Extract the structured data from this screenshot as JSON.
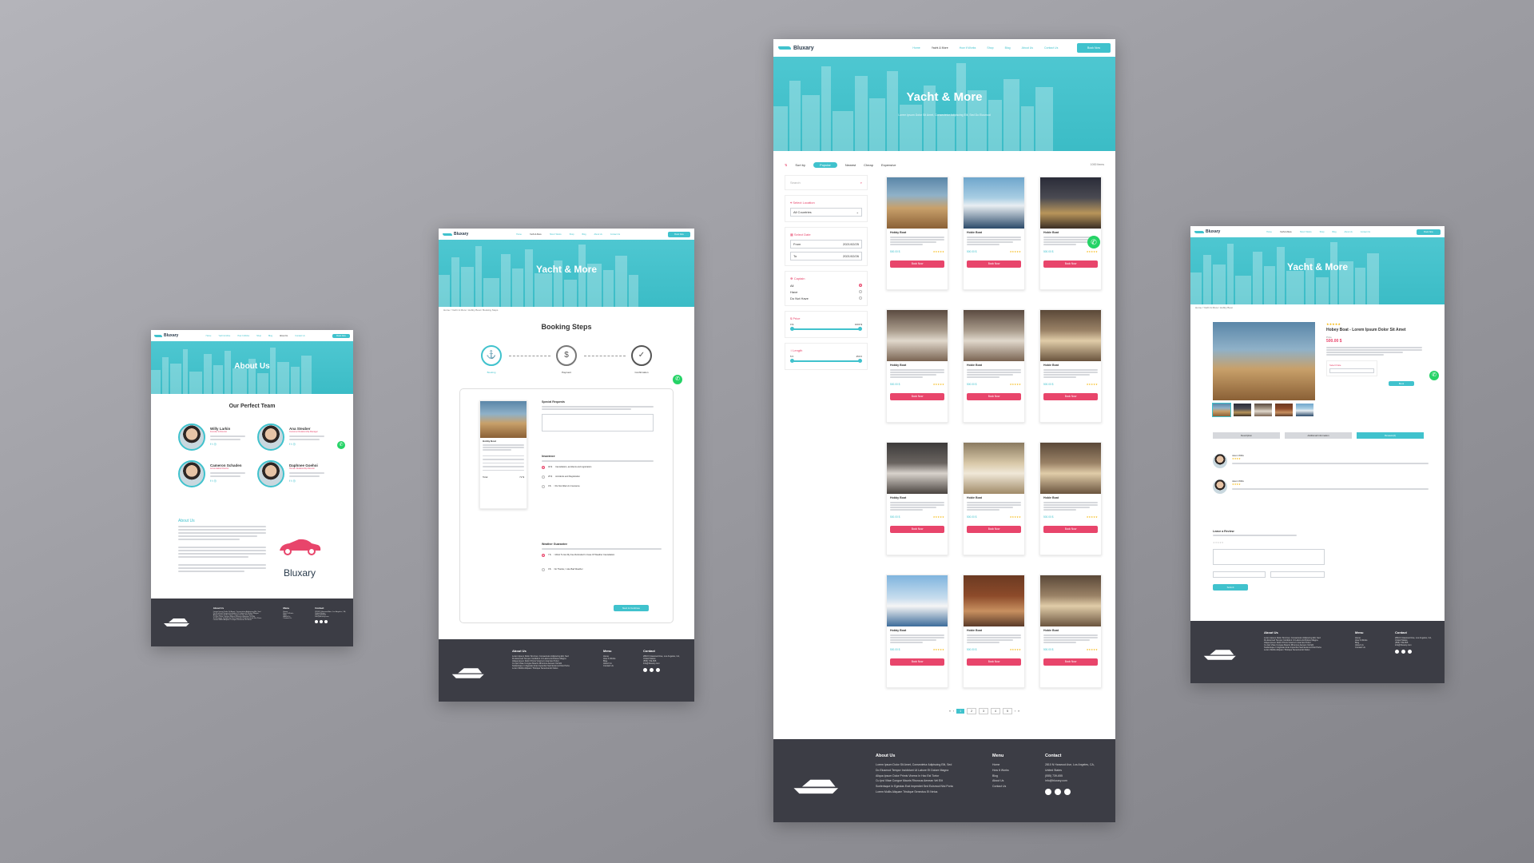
{
  "brand": {
    "name": "Bluxary",
    "accent": "#40c2cd",
    "pink": "#e8456b",
    "footer_bg": "#3c3d45"
  },
  "nav": {
    "items": [
      "Home",
      "Yacht & More",
      "How It Works",
      "Shop",
      "Blog",
      "About Us",
      "Contact Us"
    ],
    "cta": "Book Now"
  },
  "about": {
    "hero_title": "About Us",
    "team_title": "Our Perfect Team",
    "members": [
      {
        "name": "Willy Larkin",
        "role": "Founder & Director"
      },
      {
        "name": "Ana Steuber",
        "role": "Customer Relationship Manager"
      },
      {
        "name": "Cameron Schaden",
        "role": "Accountable Director"
      },
      {
        "name": "Daphnee Goehoi",
        "role": "Human Relationship Director"
      }
    ],
    "about_heading": "About Us",
    "logo_word": "Bluxary"
  },
  "booking": {
    "hero_title": "Yacht & More",
    "breadcrumb": "Home / Yacht & More / Hobby Boat / Booking Steps",
    "title": "Booking Steps",
    "steps": [
      "Booking",
      "Payment",
      "Confirmation"
    ],
    "special_requests": "Special Requests",
    "insurance": "Insurance",
    "insurance_options": [
      {
        "price": "40 $",
        "label": "Cancellation, accidents and registration"
      },
      {
        "price": "25 $",
        "label": "Accidents and Registration"
      },
      {
        "price": "0 $",
        "label": "I Do Not Want An Insurance"
      }
    ],
    "weather": "Weather Guarantee",
    "weather_options": [
      {
        "price": "7 $",
        "label": "I Want To Get My Fee Refunded In Case Of Weather Cancellation"
      },
      {
        "price": "0 $",
        "label": "No Thanks, I Like Bad Weather"
      }
    ],
    "boat_name": "Hobby Boat",
    "total_label": "Total",
    "total_value": "72 $",
    "next_button": "Next & Continue"
  },
  "listing": {
    "hero_title": "Yacht & More",
    "hero_sub": "Lorem Ipsum Dolor Sit Amet, Consectetur Adipiscing Elit, Sed Do Eiusmod",
    "sort_label": "Sort by",
    "sort_options": [
      "Popular",
      "Newest",
      "Cheap",
      "Expensive"
    ],
    "result_count": "1000 Items",
    "search_placeholder": "Search",
    "location_label": "Select Location",
    "location_value": "All Countries",
    "date_label": "Select Date",
    "from_label": "From",
    "from_value": "2021/02/25",
    "to_label": "To",
    "to_value": "2021/02/26",
    "captain_label": "Captain",
    "captain_options": [
      "All",
      "Have",
      "Do Not Have"
    ],
    "price_label": "Price",
    "price_min": "0 $",
    "price_max": "1000 $",
    "length_label": "Length",
    "length_min": "5 ft",
    "length_max": "450 ft",
    "cards": [
      {
        "name": "Hobby Boat",
        "price": "500.00 $",
        "btn": "Book Now"
      },
      {
        "name": "Hobie Boat",
        "price": "500.00 $",
        "btn": "Book Now"
      },
      {
        "name": "Hobie Boat",
        "price": "500.00 $",
        "btn": "Book Now"
      },
      {
        "name": "Hobby Boat",
        "price": "500.00 $",
        "btn": "Book Now"
      },
      {
        "name": "Hobie Boat",
        "price": "500.00 $",
        "btn": "Book Now"
      },
      {
        "name": "Hobie Boat",
        "price": "500.00 $",
        "btn": "Book Now"
      },
      {
        "name": "Hobby Boat",
        "price": "500.00 $",
        "btn": "Book Now"
      },
      {
        "name": "Hobie Boat",
        "price": "500.00 $",
        "btn": "Book Now"
      },
      {
        "name": "Hobie Boat",
        "price": "500.00 $",
        "btn": "Book Now"
      },
      {
        "name": "Hobby Boat",
        "price": "500.00 $",
        "btn": "Book Now"
      },
      {
        "name": "Hobie Boat",
        "price": "500.00 $",
        "btn": "Book Now"
      },
      {
        "name": "Hobie Boat",
        "price": "500.00 $",
        "btn": "Book Now"
      }
    ],
    "pages": [
      "1",
      "2",
      "3",
      "4",
      "5"
    ]
  },
  "detail": {
    "hero_title": "Yacht & More",
    "breadcrumb": "Home / Yacht & More / Hobby Boat",
    "title": "Hobey Boat - Lorem Ipsum Dolor Sit Amet",
    "price_label": "Price",
    "price": "500.00 $",
    "select_dates": "Select Date",
    "book_btn": "Book",
    "tabs": [
      "Description",
      "Additional Information",
      "Reviews(2)"
    ],
    "review_author": "Jason Willis",
    "leave_review": "Leave a Review",
    "submit": "Submit"
  },
  "footer": {
    "about_title": "About Us",
    "about_lines": [
      "Lorem Ipsum Dolor Sit Amet, Consectetur Adipiscing Elit, Sed",
      "Do Eiusmod Tempor Incididunt Ut Labore Et Dolore Magna",
      "Aliqua Ipsum Dolor Primis Viverra In Hac Est Tortor",
      "Cu Ipsi Vitae Congue Mauris Rhoncus Aenean Vel Elit",
      "Scelerisque In Egestas Erat Imperdiet Sed Euismod Nisi Porta",
      "Lorem Mollis Aliquam Tristique Senectus Et Netus"
    ],
    "menu_title": "Menu",
    "menu_items": [
      "Home",
      "How It Works",
      "Blog",
      "About Us",
      "Contact Us"
    ],
    "contact_title": "Contact",
    "address": "2810 N Harwood Ave, Los Angeles, CA, United States",
    "phone": "(555) 739-655",
    "email": "info@bluxary.com"
  }
}
